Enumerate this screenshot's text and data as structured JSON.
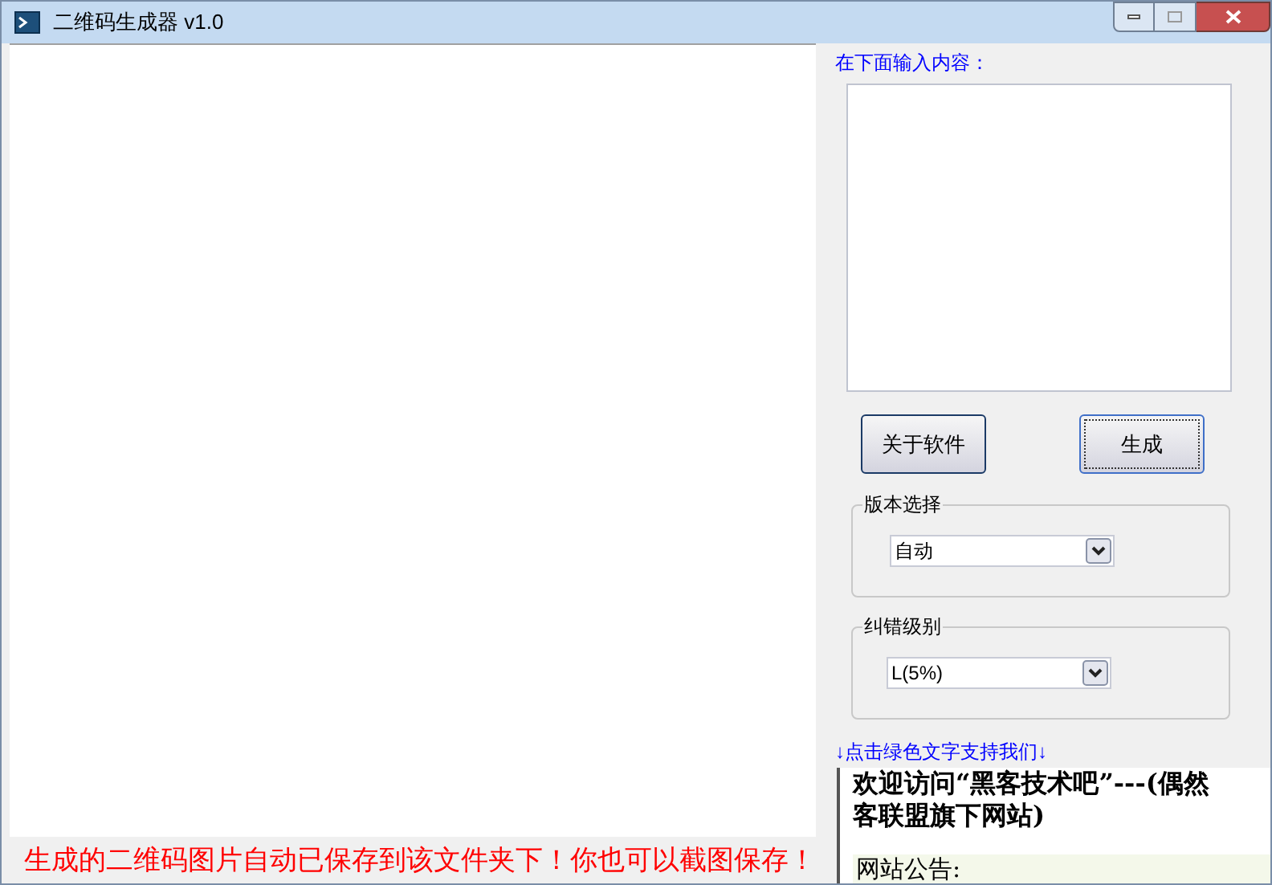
{
  "window": {
    "title": "二维码生成器 v1.0"
  },
  "status_message": "生成的二维码图片自动已保存到该文件夹下！你也可以截图保存！",
  "input": {
    "label": "在下面输入内容："
  },
  "buttons": [
    {
      "label": "关于软件",
      "focused": false
    },
    {
      "label": "生成",
      "focused": true
    }
  ],
  "groups": [
    {
      "title": "版本选择",
      "value": "自动"
    },
    {
      "title": "纠错级别",
      "value": "L(5%)"
    }
  ],
  "support_link": "↓点击绿色文字支持我们↓",
  "web_panel": {
    "lines": [
      "欢迎访问“黑客技术吧”---(偶然",
      "客联盟旗下网站)"
    ],
    "notice": "网站公告:"
  }
}
